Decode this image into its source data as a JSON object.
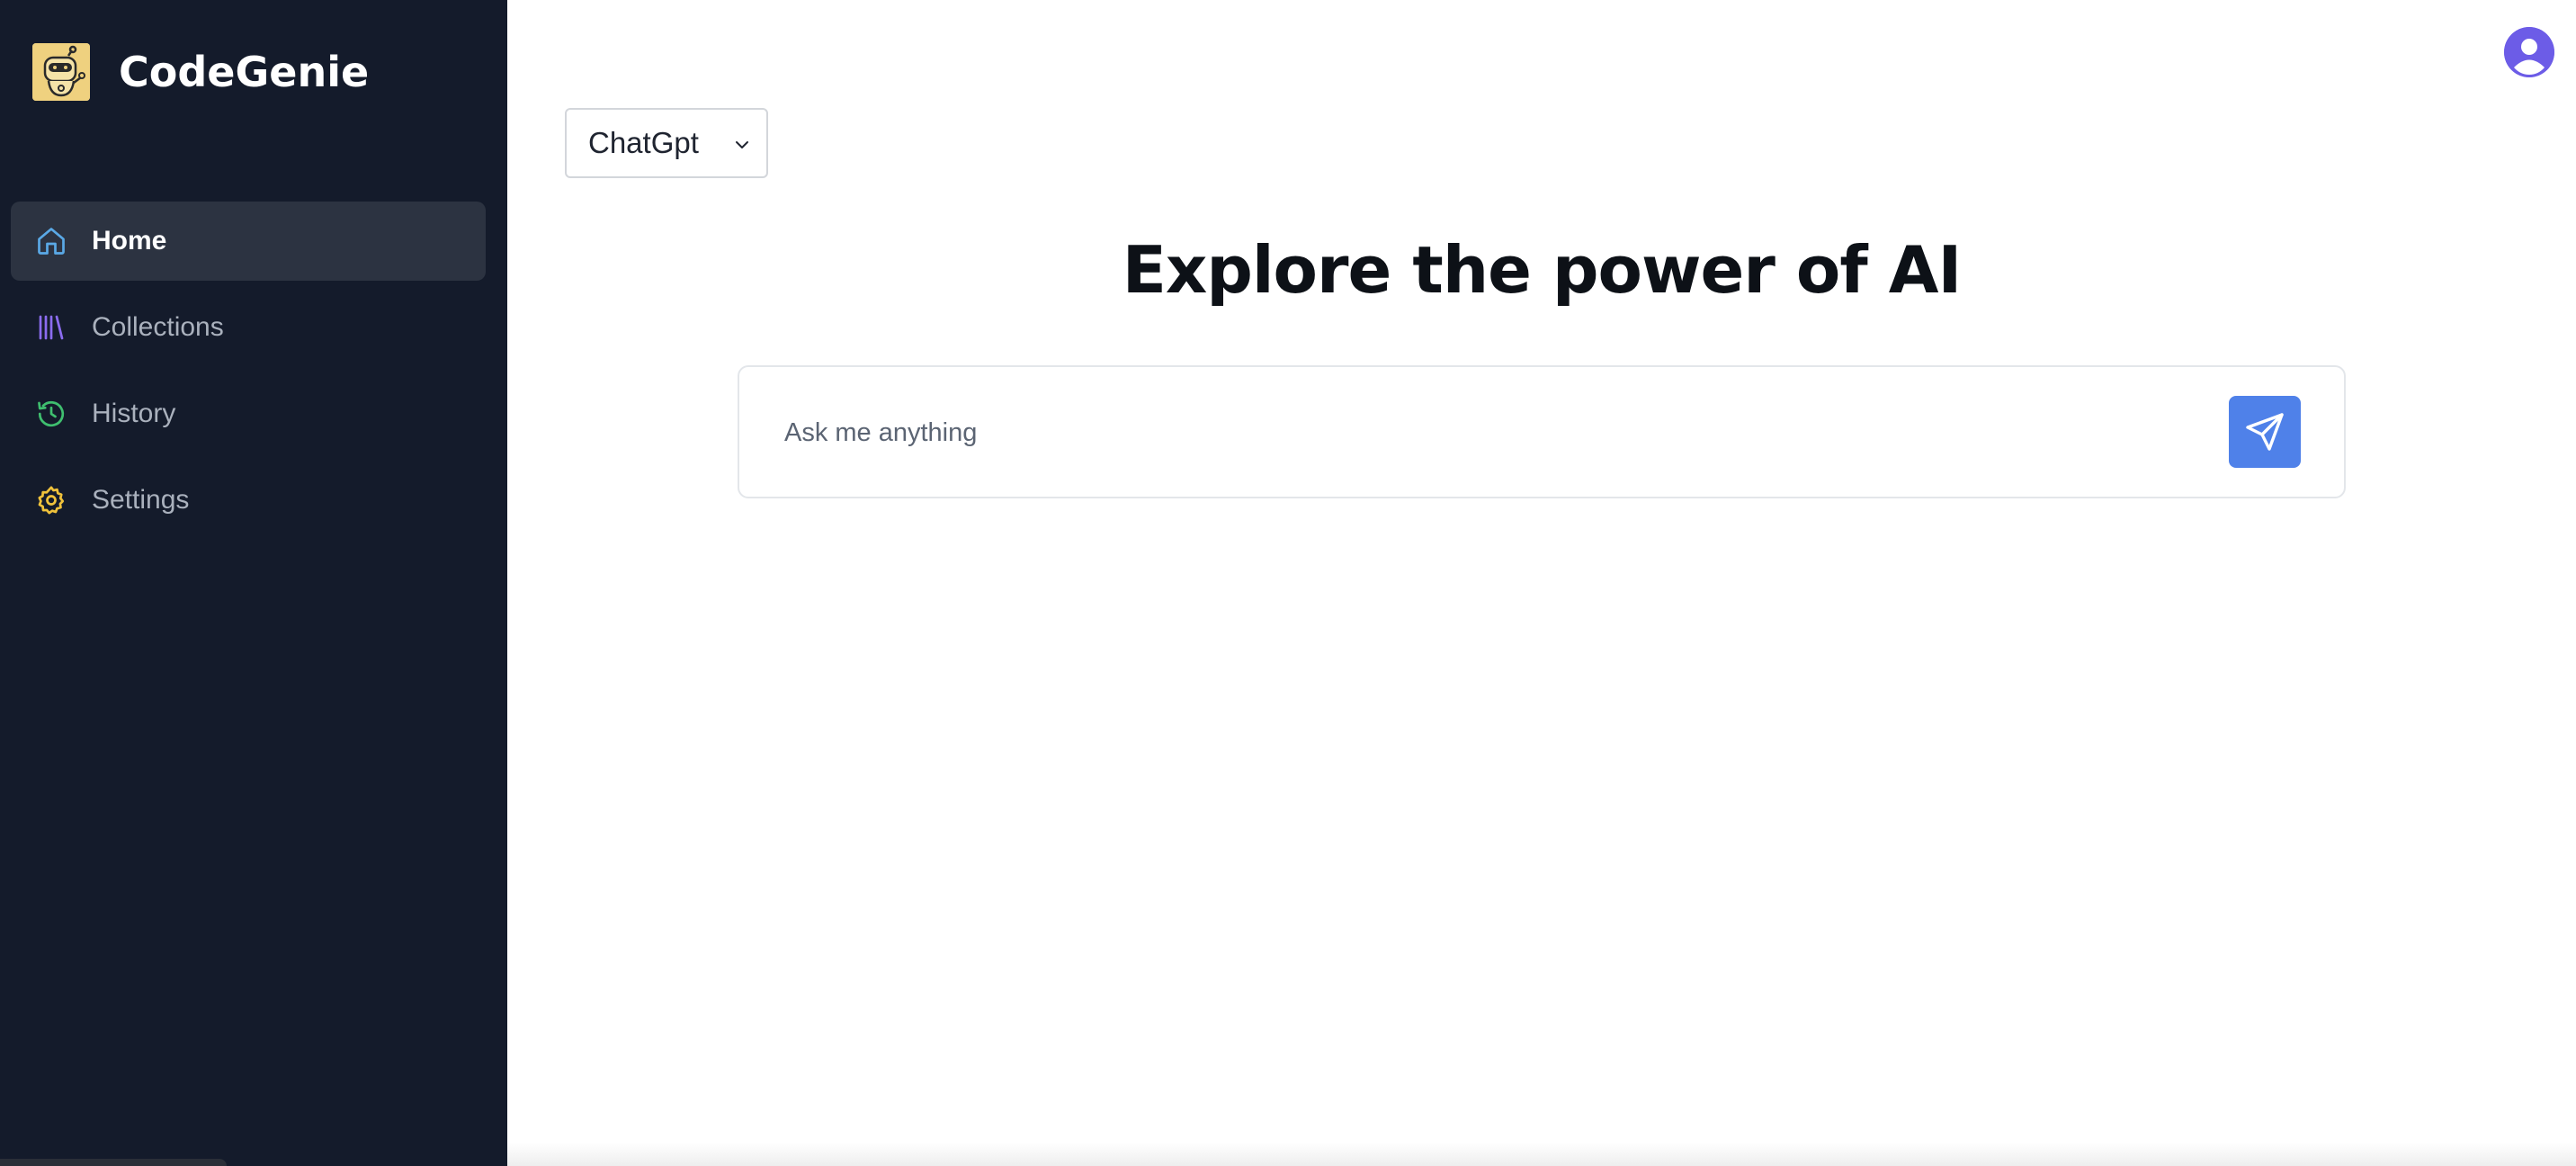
{
  "brand": {
    "name": "CodeGenie",
    "logo_icon": "robot-icon",
    "logo_color": "#efd17f"
  },
  "sidebar": {
    "background": "#141b2b",
    "items": [
      {
        "label": "Home",
        "icon": "home-icon",
        "icon_color": "#5aa9e6",
        "active": true
      },
      {
        "label": "Collections",
        "icon": "library-icon",
        "icon_color": "#8b6cf0",
        "active": false
      },
      {
        "label": "History",
        "icon": "history-icon",
        "icon_color": "#3fbf6f",
        "active": false
      },
      {
        "label": "Settings",
        "icon": "gear-icon",
        "icon_color": "#f0c23b",
        "active": false
      }
    ]
  },
  "header": {
    "avatar_icon": "user-avatar-icon",
    "avatar_color": "#6c5ce7"
  },
  "model_select": {
    "selected": "ChatGpt"
  },
  "main": {
    "title": "Explore the power of AI",
    "prompt": {
      "value": "",
      "placeholder": "Ask me anything",
      "send_icon": "send-icon",
      "send_color": "#4f81e9"
    }
  }
}
